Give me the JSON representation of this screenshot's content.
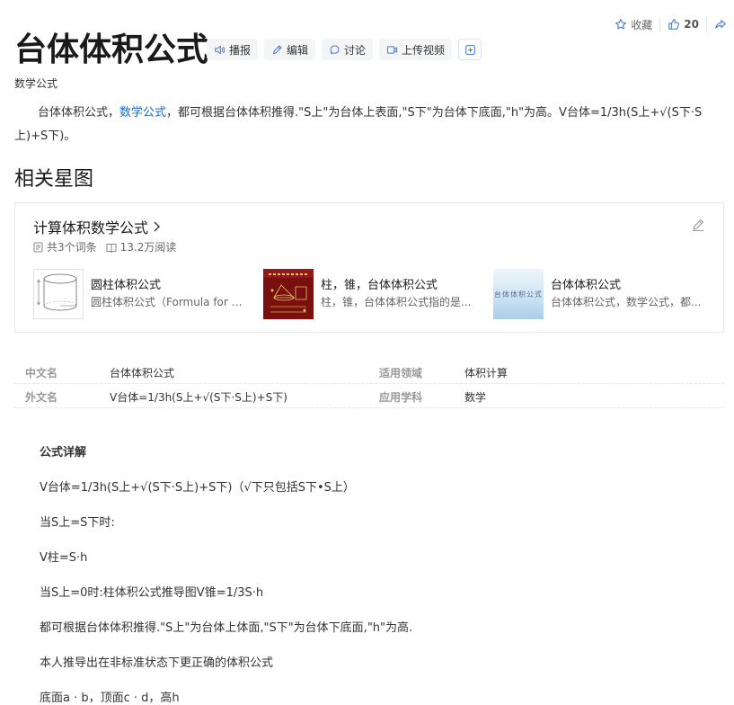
{
  "topbar": {
    "favorite": "收藏",
    "like_count": "20"
  },
  "title": "台体体积公式",
  "toolbar": {
    "play": "播报",
    "edit": "编辑",
    "discuss": "讨论",
    "upload_video": "上传视频"
  },
  "subtitle": "数学公式",
  "summary": {
    "before_link": "台体体积公式，",
    "link": "数学公式",
    "after_link": "，都可根据台体体积推得.\"S上\"为台体上表面,\"S下\"为台体下底面,\"h\"为高。V台体=1/3h(S上+√(S下·S上)+S下)。"
  },
  "related": {
    "heading": "相关星图",
    "card_title": "计算体积数学公式",
    "entry_count": "共3个词条",
    "reads": "13.2万阅读",
    "entries": [
      {
        "name": "圆柱体积公式",
        "desc": "圆柱体积公式（Formula for th..."
      },
      {
        "name": "柱，锥，台体体积公式",
        "desc": "柱，锥，台体体积公式指的是..."
      },
      {
        "name": "台体体积公式",
        "desc": "台体体积公式，数学公式，都..."
      }
    ],
    "thumb3_text": "台体体积公式"
  },
  "info": {
    "rows": [
      [
        {
          "k": "中文名",
          "v": "台体体积公式"
        },
        {
          "k": "适用领域",
          "v": "体积计算"
        }
      ],
      [
        {
          "k": "外文名",
          "v": "V台体=1/3h(S上+√(S下·S上)+S下)"
        },
        {
          "k": "应用学科",
          "v": "数学"
        }
      ]
    ]
  },
  "body": {
    "heading": "公式详解",
    "lines": [
      "V台体=1/3h(S上+√(S下·S上)+S下)（√下只包括S下•S上）",
      "当S上=S下时:",
      "V柱=S·h",
      "当S上=0时:柱体积公式推导图V锥=1/3S·h",
      "都可根据台体体积推得.\"S上\"为台体上体面,\"S下\"为台体下底面,\"h\"为高.",
      "本人推导出在非标准状态下更正确的体积公式",
      "底面a · b，顶面c · d，高h"
    ]
  },
  "colors": {
    "link": "#136ec2",
    "accent_red": "#7a0f0f"
  }
}
